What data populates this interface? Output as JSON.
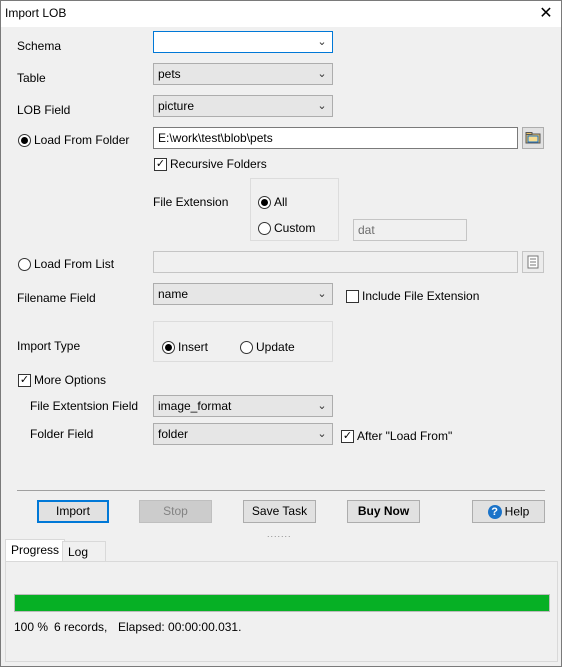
{
  "window": {
    "title": "Import LOB"
  },
  "form": {
    "schema": {
      "label": "Schema",
      "value": ""
    },
    "table": {
      "label": "Table",
      "value": "pets"
    },
    "lob_field": {
      "label": "LOB Field",
      "value": "picture"
    },
    "load_from_folder": {
      "label": "Load From Folder",
      "value": "E:\\work\\test\\blob\\pets",
      "selected": true
    },
    "recursive_folders": {
      "label": "Recursive Folders",
      "checked": true
    },
    "file_extension": {
      "label": "File Extension",
      "all_label": "All",
      "custom_label": "Custom",
      "custom_value": "dat",
      "selected": "All"
    },
    "load_from_list": {
      "label": "Load From List",
      "value": "",
      "selected": false
    },
    "filename_field": {
      "label": "Filename Field",
      "value": "name"
    },
    "include_file_extension": {
      "label": "Include File Extension",
      "checked": false
    },
    "import_type": {
      "label": "Import Type",
      "insert_label": "Insert",
      "update_label": "Update",
      "selected": "Insert"
    },
    "more_options": {
      "label": "More Options",
      "checked": true
    },
    "file_extension_field": {
      "label": "File Extentsion Field",
      "value": "image_format"
    },
    "folder_field": {
      "label": "Folder Field",
      "value": "folder"
    },
    "after_load_from": {
      "label": "After \"Load From\"",
      "checked": true
    }
  },
  "buttons": {
    "import": "Import",
    "stop": "Stop",
    "save_task": "Save Task",
    "buy_now": "Buy Now",
    "help": "Help"
  },
  "splitter": ".......",
  "tabs": {
    "progress": "Progress",
    "log": "Log"
  },
  "progress": {
    "percent": 100,
    "percent_text": "100 %",
    "records_text": "6 records,",
    "elapsed_text": "Elapsed: 00:00:00.031.",
    "fill_color": "#06b025"
  },
  "icons": {
    "close": "close-icon",
    "chevron": "chevron-down-icon",
    "folder": "folder-icon",
    "list": "list-icon",
    "help": "help-icon"
  },
  "colors": {
    "accent": "#0078d7",
    "progress": "#06b025"
  }
}
